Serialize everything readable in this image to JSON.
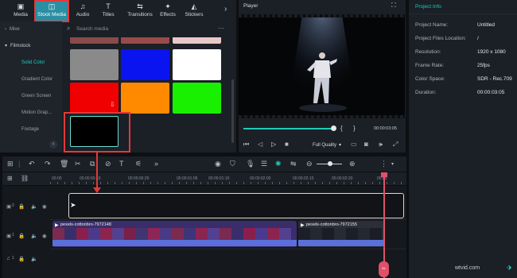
{
  "tabs": [
    {
      "label": "Media",
      "icon": "media-icon"
    },
    {
      "label": "Stock Media",
      "icon": "stock-media-icon"
    },
    {
      "label": "Audio",
      "icon": "music-note-icon"
    },
    {
      "label": "Titles",
      "icon": "title-t-icon"
    },
    {
      "label": "Transitions",
      "icon": "transitions-icon"
    },
    {
      "label": "Effects",
      "icon": "effects-sparkle-icon"
    },
    {
      "label": "Stickers",
      "icon": "stickers-icon"
    }
  ],
  "sidebar": {
    "items": [
      {
        "label": "Mixe"
      },
      {
        "label": "Filmstock"
      },
      {
        "label": "Solid Color"
      },
      {
        "label": "Gradient Color"
      },
      {
        "label": "Green Screen"
      },
      {
        "label": "Motion Grap..."
      },
      {
        "label": "Footage"
      }
    ]
  },
  "search": {
    "placeholder": "Search media"
  },
  "swatches": [
    "#8a8a8a",
    "#0a14f0",
    "#ffffff",
    "#f00000",
    "#ff8a00",
    "#18f000",
    "#000000"
  ],
  "player": {
    "title": "Player",
    "time": "00:00:03:05",
    "quality": "Full Quality"
  },
  "project_info": {
    "title": "Project Info",
    "rows": [
      {
        "label": "Project Name:",
        "value": "Untitled"
      },
      {
        "label": "Project Files Location:",
        "value": "/"
      },
      {
        "label": "Resolution:",
        "value": "1920 x 1080"
      },
      {
        "label": "Frame Rate:",
        "value": "25fps"
      },
      {
        "label": "Color Space:",
        "value": "SDR - Rec.709"
      },
      {
        "label": "Duration:",
        "value": "00:00:03:05"
      }
    ]
  },
  "timeline": {
    "ticks": [
      "00:00",
      "00:00:00:10",
      "00:00:00:20",
      "00:00:01:05",
      "00:00:01:15",
      "00:00:02:00",
      "00:00:02:10",
      "00:00:02:20",
      "00:00"
    ],
    "clips": [
      {
        "title": "pexels-cottonbro-7972148"
      },
      {
        "title": "pexels-cottonbro-7972155"
      }
    ],
    "tracks": [
      "2",
      "1",
      "1"
    ]
  },
  "watermark": "wtvid.com",
  "colors": {
    "accent": "#1ecbb8",
    "highlight": "#e03a3a",
    "playhead": "#e0506a"
  }
}
